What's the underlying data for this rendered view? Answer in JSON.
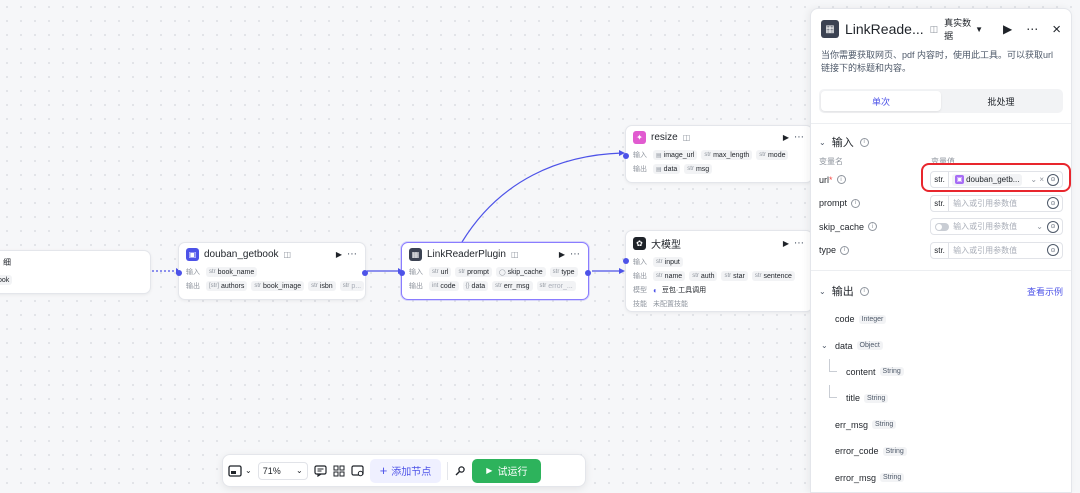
{
  "nodes": {
    "start": {
      "row1_tail": "细",
      "row2_tag": "ook"
    },
    "douban": {
      "title": "douban_getbook",
      "input_label": "输入",
      "output_label": "输出",
      "inputs": [
        "book_name"
      ],
      "outputs": [
        "authors",
        "book_image",
        "isbn",
        "p..."
      ],
      "more": "⋯"
    },
    "linkreader": {
      "title": "LinkReaderPlugin",
      "input_label": "输入",
      "output_label": "输出",
      "inputs": [
        "url",
        "prompt",
        "skip_cache",
        "type"
      ],
      "outputs": [
        "code",
        "data",
        "err_msg",
        "error_..."
      ]
    },
    "resize": {
      "title": "resize",
      "input_label": "输入",
      "output_label": "输出",
      "inputs": [
        "image_url",
        "max_length",
        "mode"
      ],
      "outputs": [
        "data",
        "msg"
      ]
    },
    "llm": {
      "title": "大模型",
      "input_label": "输入",
      "output_label": "输出",
      "model_label": "模型",
      "skill_label": "技能",
      "inputs": [
        "input"
      ],
      "outputs": [
        "name",
        "auth",
        "star",
        "sentence"
      ],
      "model_value": "豆包·工具调用",
      "skill_value": "未配置技能"
    }
  },
  "panel": {
    "title": "LinkReade...",
    "mode": "真实数据",
    "description": "当你需要获取网页、pdf 内容时，使用此工具。可以获取url链接下的标题和内容。",
    "tabs": [
      "单次",
      "批处理"
    ],
    "input_section": "输入",
    "col_name": "变量名",
    "col_value": "变量值",
    "inputs": [
      {
        "name": "url",
        "required": "*",
        "type": "str.",
        "ref": "douban_getb...",
        "ref_tools": "⌄ ×"
      },
      {
        "name": "prompt",
        "type": "str.",
        "placeholder": "输入或引用参数值"
      },
      {
        "name": "skip_cache",
        "placeholder": "输入或引用参数值"
      },
      {
        "name": "type",
        "type": "str.",
        "placeholder": "输入或引用参数值"
      }
    ],
    "output_section": "输出",
    "view_example": "查看示例",
    "outputs": [
      {
        "name": "code",
        "type": "Integer"
      },
      {
        "name": "data",
        "type": "Object"
      },
      {
        "name": "content",
        "type": "String"
      },
      {
        "name": "title",
        "type": "String"
      },
      {
        "name": "err_msg",
        "type": "String"
      },
      {
        "name": "error_code",
        "type": "String"
      },
      {
        "name": "error_msg",
        "type": "String"
      }
    ]
  },
  "toolbar": {
    "zoom": "71%",
    "add_node": "添加节点",
    "test_run": "试运行"
  },
  "colors": {
    "accent": "#4d53e8",
    "run_green": "#2db35c",
    "highlight_red": "#e8262d",
    "plugin_purple": "#a66cf5",
    "resize_pink": "#e15bd0"
  },
  "icons": [
    "run-icon",
    "more-icon",
    "close-icon",
    "help-icon",
    "reference-icon",
    "chevron-down-icon",
    "minimap-icon",
    "comment-icon",
    "layout-icon",
    "image-icon",
    "settings-icon",
    "play-icon",
    "plus-icon"
  ]
}
